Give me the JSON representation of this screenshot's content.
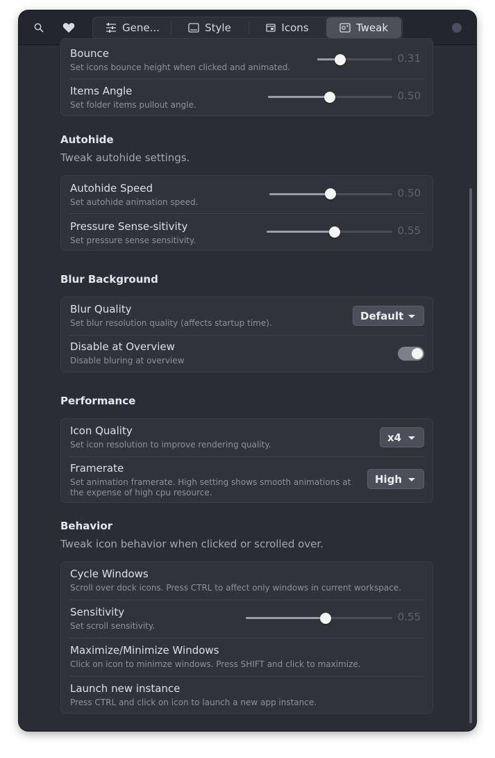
{
  "header": {
    "tabs": [
      {
        "label": "Gene...",
        "icon": "sliders-icon"
      },
      {
        "label": "Style",
        "icon": "monitor-icon"
      },
      {
        "label": "Icons",
        "icon": "window-icon"
      },
      {
        "label": "Tweak",
        "icon": "photo-gear-icon"
      }
    ],
    "active_tab": "Tweak"
  },
  "top_card": {
    "rows": [
      {
        "title": "Bounce",
        "subtitle": "Set icons bounce height when clicked and animated.",
        "value": "0.31"
      },
      {
        "title": "Items Angle",
        "subtitle": "Set folder items pullout angle.",
        "value": "0.50"
      }
    ]
  },
  "autohide": {
    "title": "Autohide",
    "desc": "Tweak autohide settings.",
    "rows": [
      {
        "title": "Autohide Speed",
        "subtitle": "Set autohide animation speed.",
        "value": "0.50"
      },
      {
        "title": "Pressure Sense-sitivity",
        "subtitle": "Set pressure sense sensitivity.",
        "value": "0.55"
      }
    ]
  },
  "blur": {
    "title": "Blur Background",
    "rows": [
      {
        "title": "Blur Quality",
        "subtitle": "Set blur resolution quality (affects startup time).",
        "selected": "Default"
      },
      {
        "title": "Disable at Overview",
        "subtitle": "Disable bluring at overview",
        "toggle_on": true
      }
    ]
  },
  "performance": {
    "title": "Performance",
    "rows": [
      {
        "title": "Icon Quality",
        "subtitle": "Set icon resolution to improve rendering quality.",
        "selected": "x4"
      },
      {
        "title": "Framerate",
        "subtitle_line1": "Set animation framerate. High setting shows smooth animations at",
        "subtitle_line2": "the expense of high cpu resource.",
        "selected": "High"
      }
    ]
  },
  "behavior": {
    "title": "Behavior",
    "desc": "Tweak icon behavior when clicked or scrolled over.",
    "rows": [
      {
        "title": "Cycle Windows",
        "subtitle": "Scroll over dock icons. Press CTRL to affect only windows in current workspace."
      },
      {
        "title": "Sensitivity",
        "subtitle": "Set scroll sensitivity.",
        "value": "0.55"
      },
      {
        "title": "Maximize/Minimize Windows",
        "subtitle": "Click on icon to minimze windows. Press SHIFT and click to maximize."
      },
      {
        "title": "Launch new instance",
        "subtitle": "Press CTRL and click on icon to launch a new app instance."
      }
    ]
  },
  "colors": {
    "window_bg": "#2a2d34",
    "card_bg": "#30333a",
    "accent_dot": "#4a5062"
  }
}
